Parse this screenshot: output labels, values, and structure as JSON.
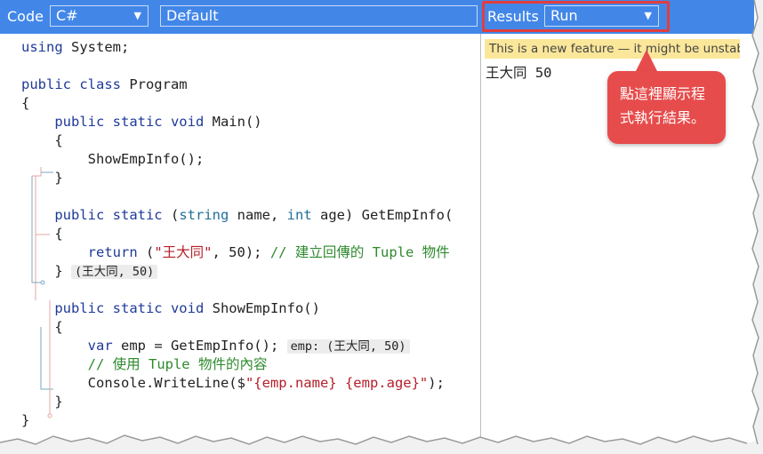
{
  "toolbar": {
    "code_label": "Code",
    "language_value": "C#",
    "mode_value": "Default",
    "results_label": "Results",
    "run_value": "Run"
  },
  "code_lines": [
    "using System;",
    "",
    "public class Program",
    "{",
    "    public static void Main()",
    "    {",
    "        ShowEmpInfo();",
    "    }",
    "",
    "    public static (string name, int age) GetEmpInfo(",
    "    {",
    "        return (\"王大同\", 50); // 建立回傳的 Tuple 物件",
    "    } ",
    "",
    "    public static void ShowEmpInfo()",
    "    {",
    "        var emp = GetEmpInfo(); ",
    "        // 使用 Tuple 物件的內容",
    "        Console.WriteLine($\"{emp.name} {emp.age}\");",
    "    }",
    "}"
  ],
  "inline_hints": {
    "getempinfo_return": "(王大同, 50)",
    "emp_value": "emp: (王大同, 50)"
  },
  "results": {
    "banner_text": "This is a new feature — it might be unstable",
    "output_text": "王大同 50"
  },
  "callout": {
    "line1": "點這裡顯示程",
    "line2": "式執行結果。"
  },
  "colors": {
    "toolbar_bg": "#4287e8",
    "callout_bg": "#e74c4c",
    "highlight_border": "#e23d3d",
    "banner_bg": "#fbe79a"
  }
}
